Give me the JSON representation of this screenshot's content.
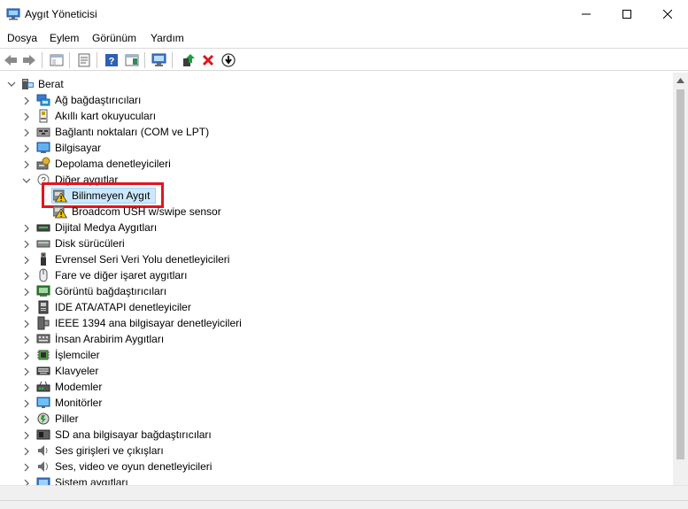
{
  "window": {
    "title": "Aygıt Yöneticisi"
  },
  "menu": [
    "Dosya",
    "Eylem",
    "Görünüm",
    "Yardım"
  ],
  "tree": {
    "root": "Berat",
    "categories": [
      {
        "label": "Ağ bağdaştırıcıları",
        "icon": "network-adapter-icon"
      },
      {
        "label": "Akıllı kart okuyucuları",
        "icon": "smart-card-reader-icon"
      },
      {
        "label": "Bağlantı noktaları (COM ve LPT)",
        "icon": "port-icon"
      },
      {
        "label": "Bilgisayar",
        "icon": "computer-icon"
      },
      {
        "label": "Depolama denetleyicileri",
        "icon": "storage-controller-icon"
      },
      {
        "label": "Diğer aygıtlar",
        "icon": "other-devices-icon",
        "expanded": true,
        "children": [
          {
            "label": "Bilinmeyen Aygıt",
            "icon": "warning-device-icon",
            "selected": true
          },
          {
            "label": "Broadcom USH w/swipe sensor",
            "icon": "warning-device-icon"
          }
        ]
      },
      {
        "label": "Dijital Medya Aygıtları",
        "icon": "digital-media-icon"
      },
      {
        "label": "Disk sürücüleri",
        "icon": "disk-drive-icon"
      },
      {
        "label": "Evrensel Seri Veri Yolu denetleyicileri",
        "icon": "usb-icon"
      },
      {
        "label": "Fare ve diğer işaret aygıtları",
        "icon": "mouse-icon"
      },
      {
        "label": "Görüntü bağdaştırıcıları",
        "icon": "display-adapter-icon"
      },
      {
        "label": "IDE ATA/ATAPI denetleyiciler",
        "icon": "ide-controller-icon"
      },
      {
        "label": "IEEE 1394 ana bilgisayar denetleyicileri",
        "icon": "ieee1394-icon"
      },
      {
        "label": "İnsan Arabirim Aygıtları",
        "icon": "hid-icon"
      },
      {
        "label": "İşlemciler",
        "icon": "processor-icon"
      },
      {
        "label": "Klavyeler",
        "icon": "keyboard-icon"
      },
      {
        "label": "Modemler",
        "icon": "modem-icon"
      },
      {
        "label": "Monitörler",
        "icon": "monitor-icon"
      },
      {
        "label": "Piller",
        "icon": "battery-icon"
      },
      {
        "label": "SD ana bilgisayar bağdaştırıcıları",
        "icon": "sd-host-icon"
      },
      {
        "label": "Ses girişleri ve çıkışları",
        "icon": "audio-io-icon"
      },
      {
        "label": "Ses, video ve oyun denetleyicileri",
        "icon": "sound-video-icon"
      },
      {
        "label": "Sistem aygıtları",
        "icon": "system-devices-icon"
      }
    ]
  },
  "colors": {
    "selection": "#cce8ff",
    "highlight_frame": "#e3141f",
    "warning": "#f5c400"
  }
}
